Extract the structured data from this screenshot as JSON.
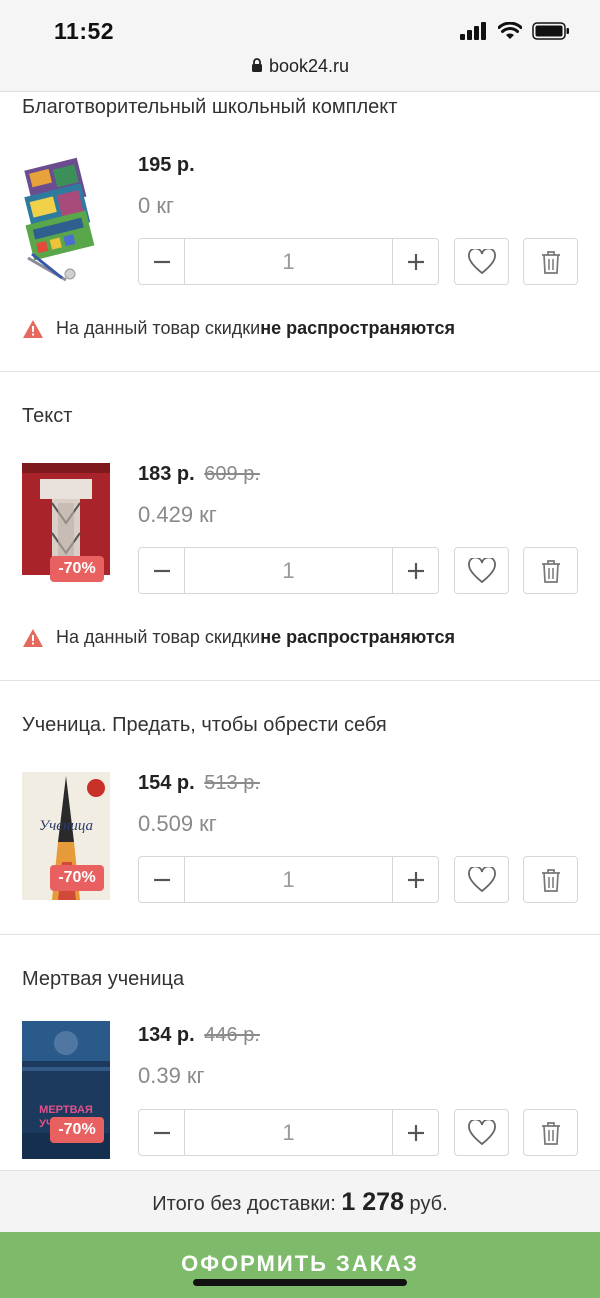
{
  "status_bar": {
    "time": "11:52"
  },
  "browser": {
    "url": "book24.ru"
  },
  "labels": {
    "notice_prefix": "На данный товар скидки ",
    "notice_bold": "не распространяются"
  },
  "items": [
    {
      "title": "Благотворительный школьный комплект",
      "price": "195 р.",
      "old_price": "",
      "weight": "0 кг",
      "quantity": "1",
      "discount": ""
    },
    {
      "title": "Текст",
      "price": "183 р.",
      "old_price": "609 р.",
      "weight": "0.429 кг",
      "quantity": "1",
      "discount": "-70%"
    },
    {
      "title": "Ученица. Предать, чтобы обрести себя",
      "price": "154 р.",
      "old_price": "513 р.",
      "weight": "0.509 кг",
      "quantity": "1",
      "discount": "-70%"
    },
    {
      "title": "Мертвая ученица",
      "price": "134 р.",
      "old_price": "446 р.",
      "weight": "0.39 кг",
      "quantity": "1",
      "discount": "-70%"
    }
  ],
  "summary": {
    "label": "Итого без доставки: ",
    "total": "1 278",
    "currency": " руб."
  },
  "checkout": {
    "label": "ОФОРМИТЬ ЗАКАЗ"
  },
  "colors": {
    "accent_green": "#7dbb6a",
    "discount_red": "#e96060",
    "warning_red": "#e56a5e"
  }
}
